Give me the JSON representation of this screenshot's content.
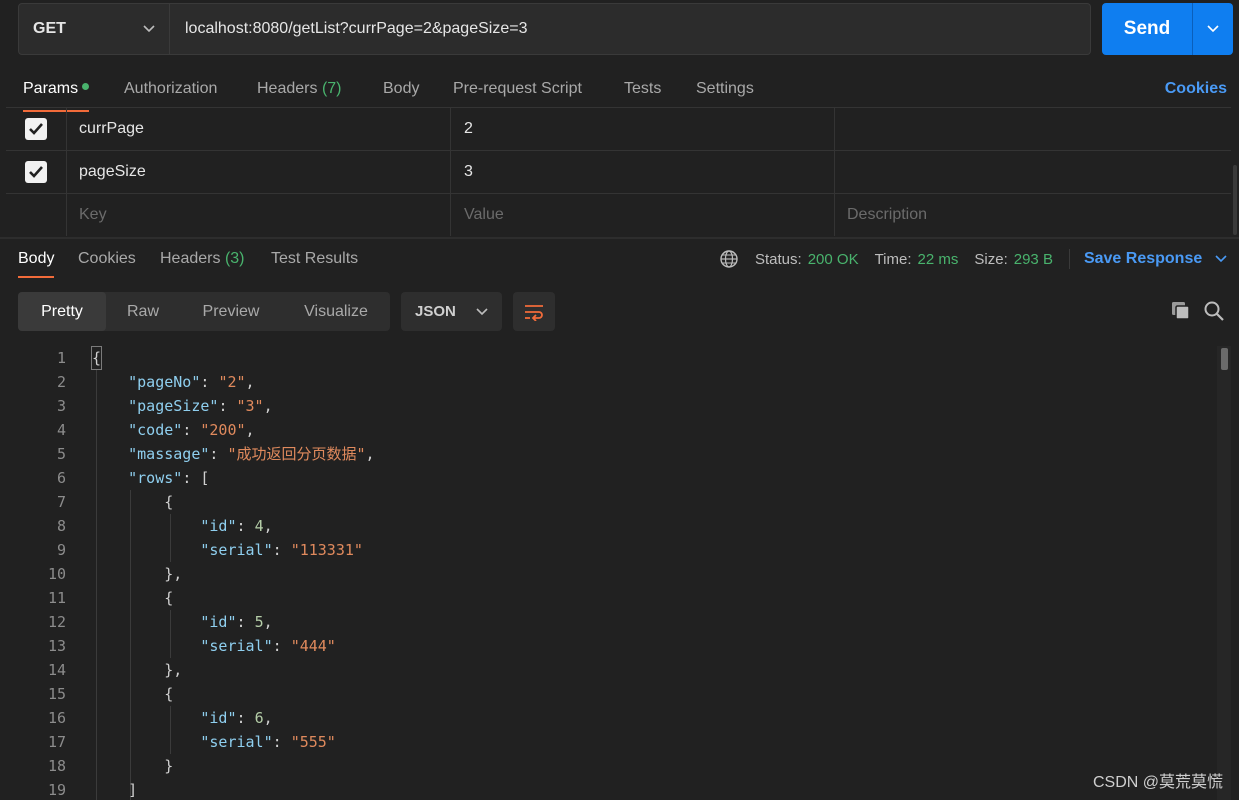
{
  "request": {
    "method": "GET",
    "url": "localhost:8080/getList?currPage=2&pageSize=3",
    "send_label": "Send"
  },
  "req_tabs": {
    "params": "Params",
    "authorization": "Authorization",
    "headers": "Headers",
    "headers_count": "(7)",
    "body": "Body",
    "prerequest": "Pre-request Script",
    "tests": "Tests",
    "settings": "Settings",
    "cookies": "Cookies"
  },
  "params": {
    "rows": [
      {
        "checked": true,
        "key": "currPage",
        "value": "2",
        "description": ""
      },
      {
        "checked": true,
        "key": "pageSize",
        "value": "3",
        "description": ""
      }
    ],
    "placeholders": {
      "key": "Key",
      "value": "Value",
      "description": "Description"
    }
  },
  "resp_tabs": {
    "body": "Body",
    "cookies": "Cookies",
    "headers": "Headers",
    "headers_count": "(3)",
    "test_results": "Test Results"
  },
  "status": {
    "status_label": "Status:",
    "status_value": "200 OK",
    "time_label": "Time:",
    "time_value": "22 ms",
    "size_label": "Size:",
    "size_value": "293 B",
    "save_label": "Save Response"
  },
  "view": {
    "pretty": "Pretty",
    "raw": "Raw",
    "preview": "Preview",
    "visualize": "Visualize",
    "format": "JSON"
  },
  "code_lines": [
    {
      "n": "1"
    },
    {
      "n": "2"
    },
    {
      "n": "3"
    },
    {
      "n": "4"
    },
    {
      "n": "5"
    },
    {
      "n": "6"
    },
    {
      "n": "7"
    },
    {
      "n": "8"
    },
    {
      "n": "9"
    },
    {
      "n": "10"
    },
    {
      "n": "11"
    },
    {
      "n": "12"
    },
    {
      "n": "13"
    },
    {
      "n": "14"
    },
    {
      "n": "15"
    },
    {
      "n": "16"
    },
    {
      "n": "17"
    },
    {
      "n": "18"
    },
    {
      "n": "19"
    }
  ],
  "json": {
    "k_pageNo": "\"pageNo\"",
    "v_pageNo": "\"2\"",
    "k_pageSize": "\"pageSize\"",
    "v_pageSize": "\"3\"",
    "k_code": "\"code\"",
    "v_code": "\"200\"",
    "k_massage": "\"massage\"",
    "v_massage": "\"成功返回分页数据\"",
    "k_rows": "\"rows\"",
    "k_id": "\"id\"",
    "k_serial": "\"serial\"",
    "id1": "4",
    "serial1": "\"113331\"",
    "id2": "5",
    "serial2": "\"444\"",
    "id3": "6",
    "serial3": "\"555\""
  },
  "watermark": "CSDN @莫荒莫慌",
  "colors": {
    "accent": "#f26b3a",
    "send": "#0f7ef0",
    "status_ok": "#49b36d",
    "link": "#4a9af5"
  }
}
